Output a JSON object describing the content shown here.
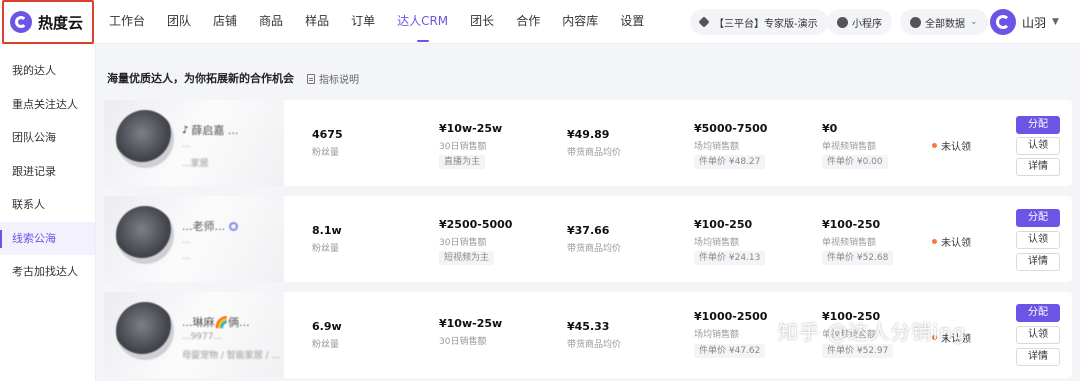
{
  "brand": {
    "name": "热度云"
  },
  "nav": [
    "工作台",
    "团队",
    "店铺",
    "商品",
    "样品",
    "订单",
    "达人CRM",
    "团长",
    "合作",
    "内容库",
    "设置"
  ],
  "nav_active_index": 6,
  "header": {
    "plan": "【三平台】专家版-演示",
    "mini_program": "小程序",
    "data_scope": "全部数据",
    "user_name": "山羽"
  },
  "sidebar": {
    "items": [
      "我的达人",
      "重点关注达人",
      "团队公海",
      "跟进记录",
      "联系人",
      "线索公海",
      "考古加找达人"
    ],
    "active_index": 5
  },
  "main": {
    "banner": "海量优质达人，为你拓展新的合作机会",
    "metric_link": "指标说明"
  },
  "labels": {
    "fans": "粉丝量",
    "sales_30d": "30日销售额",
    "avg_price": "带货商品均价",
    "field_sales": "场均销售额",
    "single_video_sales": "单视频销售额",
    "unit_price_prefix": "件单价",
    "status": "未认领",
    "assign": "分配",
    "claim": "认领",
    "detail": "详情"
  },
  "cards": [
    {
      "name": "薛启嘉 ...",
      "sub": "...",
      "sub2": "...家居",
      "fans": "4675",
      "sales_30d": "¥10w-25w",
      "sales_tag": "直播为主",
      "avg_price": "¥49.89",
      "field_sales": "¥5000-7500",
      "field_unit": "件单价 ¥48.27",
      "video_sales": "¥0",
      "video_unit": "件单价 ¥0.00"
    },
    {
      "name": "...老师...",
      "sub": "...",
      "sub2": "...",
      "fans": "8.1w",
      "sales_30d": "¥2500-5000",
      "sales_tag": "短视频为主",
      "avg_price": "¥37.66",
      "field_sales": "¥100-250",
      "field_unit": "件单价 ¥24.13",
      "video_sales": "¥100-250",
      "video_unit": "件单价 ¥52.68"
    },
    {
      "name": "...琳麻🌈俩...",
      "sub": "...9977...",
      "sub2": "母婴宠物 / 智能家居 / ...",
      "fans": "6.9w",
      "sales_30d": "¥10w-25w",
      "sales_tag": "",
      "avg_price": "¥45.33",
      "field_sales": "¥1000-2500",
      "field_unit": "件单价 ¥47.62",
      "video_sales": "¥100-250",
      "video_unit": "件单价 ¥52.97"
    }
  ],
  "watermark": "知乎 @达人分销ing",
  "colors": {
    "accent": "#6c55e6",
    "status_dot": "#f47a3c",
    "brand_outline": "#d9402b"
  },
  "icons": [
    "brand-logo-icon",
    "diamond-icon",
    "mini-program-icon",
    "eye-icon",
    "chevron-down-icon",
    "document-icon",
    "douyin-icon",
    "verified-icon"
  ]
}
